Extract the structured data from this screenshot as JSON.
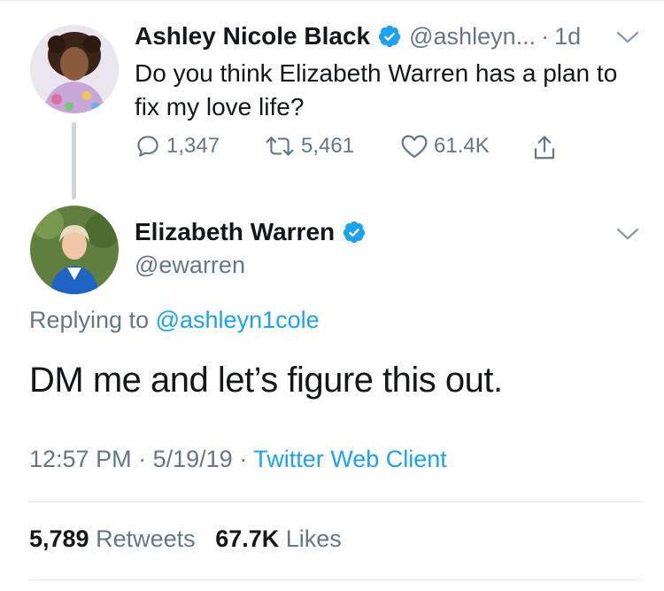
{
  "parent_tweet": {
    "author_name": "Ashley Nicole Black",
    "handle": "@ashleyn...",
    "time_ago": "1d",
    "text": "Do you think Elizabeth Warren has a plan to fix my love life?",
    "reply_count": "1,347",
    "retweet_count": "5,461",
    "like_count": "61.4K"
  },
  "reply_tweet": {
    "author_name": "Elizabeth Warren",
    "handle": "@ewarren",
    "replying_prefix": "Replying to",
    "replying_to": "@ashleyn1cole",
    "text": "DM me and let’s figure this out.",
    "time": "12:57 PM",
    "date": "5/19/19",
    "client": "Twitter Web Client",
    "retweets_count": "5,789",
    "retweets_label": "Retweets",
    "likes_count": "67.7K",
    "likes_label": "Likes"
  },
  "colors": {
    "accent": "#1da1f2",
    "muted": "#657786",
    "text": "#14171a"
  },
  "icons": [
    "verified-badge-icon",
    "chevron-down-icon",
    "reply-icon",
    "retweet-icon",
    "like-icon",
    "share-icon"
  ]
}
